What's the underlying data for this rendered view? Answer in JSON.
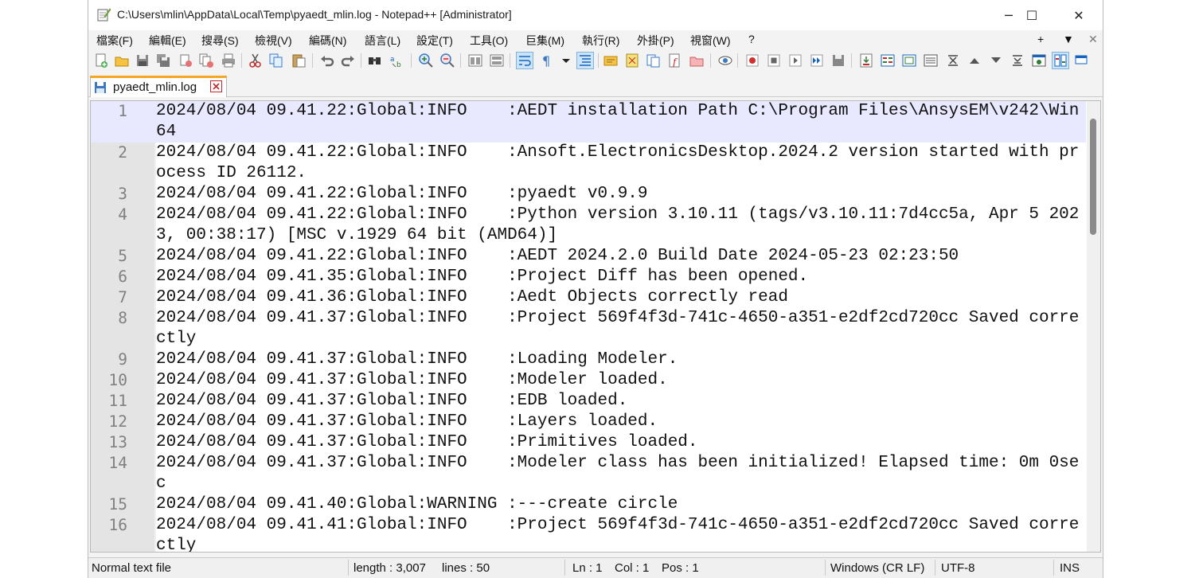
{
  "window": {
    "title": "C:\\Users\\mlin\\AppData\\Local\\Temp\\pyaedt_mlin.log - Notepad++ [Administrator]",
    "min_glyph": "─",
    "max_glyph": "☐",
    "close_glyph": "✕"
  },
  "menu": {
    "items": [
      "檔案(F)",
      "編輯(E)",
      "搜尋(S)",
      "檢視(V)",
      "編碼(N)",
      "語言(L)",
      "設定(T)",
      "工具(O)",
      "巨集(M)",
      "執行(R)",
      "外掛(P)",
      "視窗(W)",
      "?"
    ],
    "right": [
      "+",
      "▼",
      "✕"
    ]
  },
  "tab": {
    "label": "pyaedt_mlin.log"
  },
  "editor": {
    "lines": [
      {
        "num": "1",
        "text": "2024/08/04 09.41.22:Global:INFO    :AEDT installation Path C:\\Program Files\\AnsysEM\\v242\\Win64"
      },
      {
        "num": "2",
        "text": "2024/08/04 09.41.22:Global:INFO    :Ansoft.ElectronicsDesktop.2024.2 version started with process ID 26112."
      },
      {
        "num": "3",
        "text": "2024/08/04 09.41.22:Global:INFO    :pyaedt v0.9.9"
      },
      {
        "num": "4",
        "text": "2024/08/04 09.41.22:Global:INFO    :Python version 3.10.11 (tags/v3.10.11:7d4cc5a, Apr 5 2023, 00:38:17) [MSC v.1929 64 bit (AMD64)]"
      },
      {
        "num": "5",
        "text": "2024/08/04 09.41.22:Global:INFO    :AEDT 2024.2.0 Build Date 2024-05-23 02:23:50"
      },
      {
        "num": "6",
        "text": "2024/08/04 09.41.35:Global:INFO    :Project Diff has been opened."
      },
      {
        "num": "7",
        "text": "2024/08/04 09.41.36:Global:INFO    :Aedt Objects correctly read"
      },
      {
        "num": "8",
        "text": "2024/08/04 09.41.37:Global:INFO    :Project 569f4f3d-741c-4650-a351-e2df2cd720cc Saved correctly"
      },
      {
        "num": "9",
        "text": "2024/08/04 09.41.37:Global:INFO    :Loading Modeler."
      },
      {
        "num": "10",
        "text": "2024/08/04 09.41.37:Global:INFO    :Modeler loaded."
      },
      {
        "num": "11",
        "text": "2024/08/04 09.41.37:Global:INFO    :EDB loaded."
      },
      {
        "num": "12",
        "text": "2024/08/04 09.41.37:Global:INFO    :Layers loaded."
      },
      {
        "num": "13",
        "text": "2024/08/04 09.41.37:Global:INFO    :Primitives loaded."
      },
      {
        "num": "14",
        "text": "2024/08/04 09.41.37:Global:INFO    :Modeler class has been initialized! Elapsed time: 0m 0sec"
      },
      {
        "num": "15",
        "text": "2024/08/04 09.41.40:Global:WARNING :---create circle"
      },
      {
        "num": "16",
        "text": "2024/08/04 09.41.41:Global:INFO    :Project 569f4f3d-741c-4650-a351-e2df2cd720cc Saved correctly"
      }
    ]
  },
  "status": {
    "file_type": "Normal text file",
    "length": "length : 3,007",
    "lines": "lines : 50",
    "ln": "Ln : 1",
    "col": "Col : 1",
    "pos": "Pos : 1",
    "eol": "Windows (CR LF)",
    "encoding": "UTF-8",
    "mode": "INS"
  },
  "colors": {
    "current_line": "#e8e8ff",
    "gutter": "#e4e4e4",
    "tab_accent": "#f5a623"
  }
}
